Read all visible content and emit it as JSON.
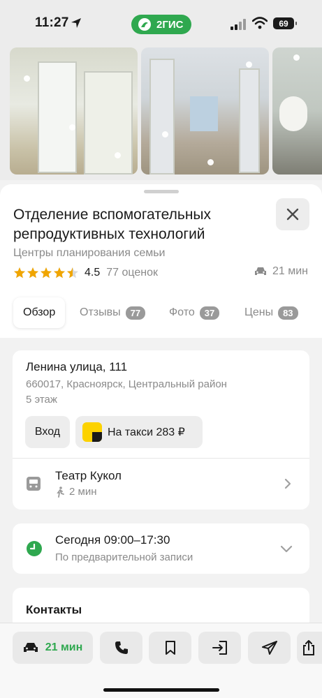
{
  "status_bar": {
    "time": "11:27",
    "app_badge": "2ГИС",
    "battery": "69"
  },
  "place": {
    "title": "Отделение вспомогательных репродуктивных технологий",
    "category": "Центры планирования семьи",
    "rating": "4.5",
    "rating_stars": 4.5,
    "rating_count": "77 оценок",
    "drive_time": "21 мин"
  },
  "tabs": [
    {
      "label": "Обзор",
      "count": ""
    },
    {
      "label": "Отзывы",
      "count": "77"
    },
    {
      "label": "Фото",
      "count": "37"
    },
    {
      "label": "Цены",
      "count": "83"
    }
  ],
  "address": {
    "street": "Ленина улица, 111",
    "details": "660017, Красноярск, Центральный район",
    "floor": "5 этаж",
    "entry_label": "Вход",
    "taxi_label": "На такси 283 ₽",
    "stop_name": "Театр Кукол",
    "walk_time": "2 мин"
  },
  "hours": {
    "main": "Сегодня 09:00–17:30",
    "note": "По предварительной записи"
  },
  "contacts": {
    "title": "Контакты"
  },
  "action_bar": {
    "route_label": "21 мин"
  },
  "colors": {
    "brand_green": "#2fa84f",
    "star_gold": "#f0a500",
    "taxi_yellow": "#fcd200"
  },
  "icons": [
    "location-arrow-icon",
    "signal-icon",
    "wifi-icon",
    "close-icon",
    "star-icon",
    "car-icon",
    "bus-icon",
    "walk-icon",
    "chevron-right-icon",
    "clock-icon",
    "chevron-down-icon",
    "phone-icon",
    "bookmark-icon",
    "enter-icon",
    "send-icon",
    "share-icon"
  ]
}
